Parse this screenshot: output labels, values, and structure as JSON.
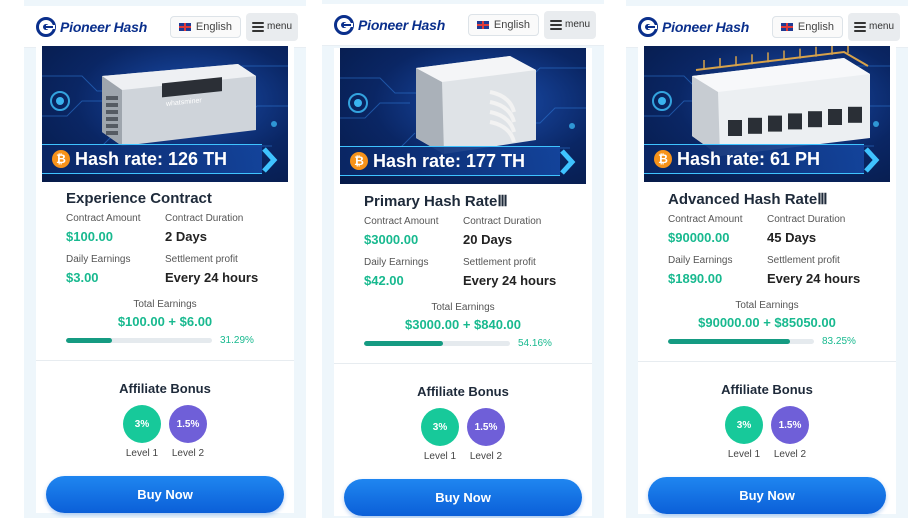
{
  "brand": {
    "name": "Pioneer Hash"
  },
  "header": {
    "language": "English",
    "menu_label": "menu"
  },
  "labels": {
    "contract_amount": "Contract Amount",
    "contract_duration": "Contract Duration",
    "daily_earnings": "Daily Earnings",
    "settlement_profit": "Settlement profit",
    "total_earnings": "Total Earnings",
    "affiliate_bonus": "Affiliate Bonus",
    "buy_now": "Buy Now",
    "level1": "Level 1",
    "level2": "Level 2"
  },
  "affiliate": {
    "level1_pct": "3%",
    "level2_pct": "1.5%"
  },
  "colors": {
    "brand": "#0a2f8c",
    "accent_green": "#18b98f",
    "button_blue": "#0b5fd8",
    "level1": "#17c99a",
    "level2": "#6f5fd8"
  },
  "cards": [
    {
      "hash_rate": "Hash rate: 126 TH",
      "title": "Experience Contract",
      "contract_amount": "$100.00",
      "contract_duration": "2 Days",
      "daily_earnings": "$3.00",
      "settlement_profit": "Every 24 hours",
      "total_earnings": "$100.00 + $6.00",
      "progress": 0.3129,
      "progress_label": "31.29%",
      "machine_icon": "asic-miner-icon"
    },
    {
      "hash_rate": "Hash rate: 177 TH",
      "title": "Primary Hash RateⅢ",
      "contract_amount": "$3000.00",
      "contract_duration": "20 Days",
      "daily_earnings": "$42.00",
      "settlement_profit": "Every 24 hours",
      "total_earnings": "$3000.00 + $840.00",
      "progress": 0.5416,
      "progress_label": "54.16%",
      "machine_icon": "asic-miner-icon"
    },
    {
      "hash_rate": "Hash rate: 61 PH",
      "title": "Advanced Hash RateⅢ",
      "contract_amount": "$90000.00",
      "contract_duration": "45 Days",
      "daily_earnings": "$1890.00",
      "settlement_profit": "Every 24 hours",
      "total_earnings": "$90000.00 + $85050.00",
      "progress": 0.8325,
      "progress_label": "83.25%",
      "machine_icon": "container-datacenter-icon"
    }
  ]
}
